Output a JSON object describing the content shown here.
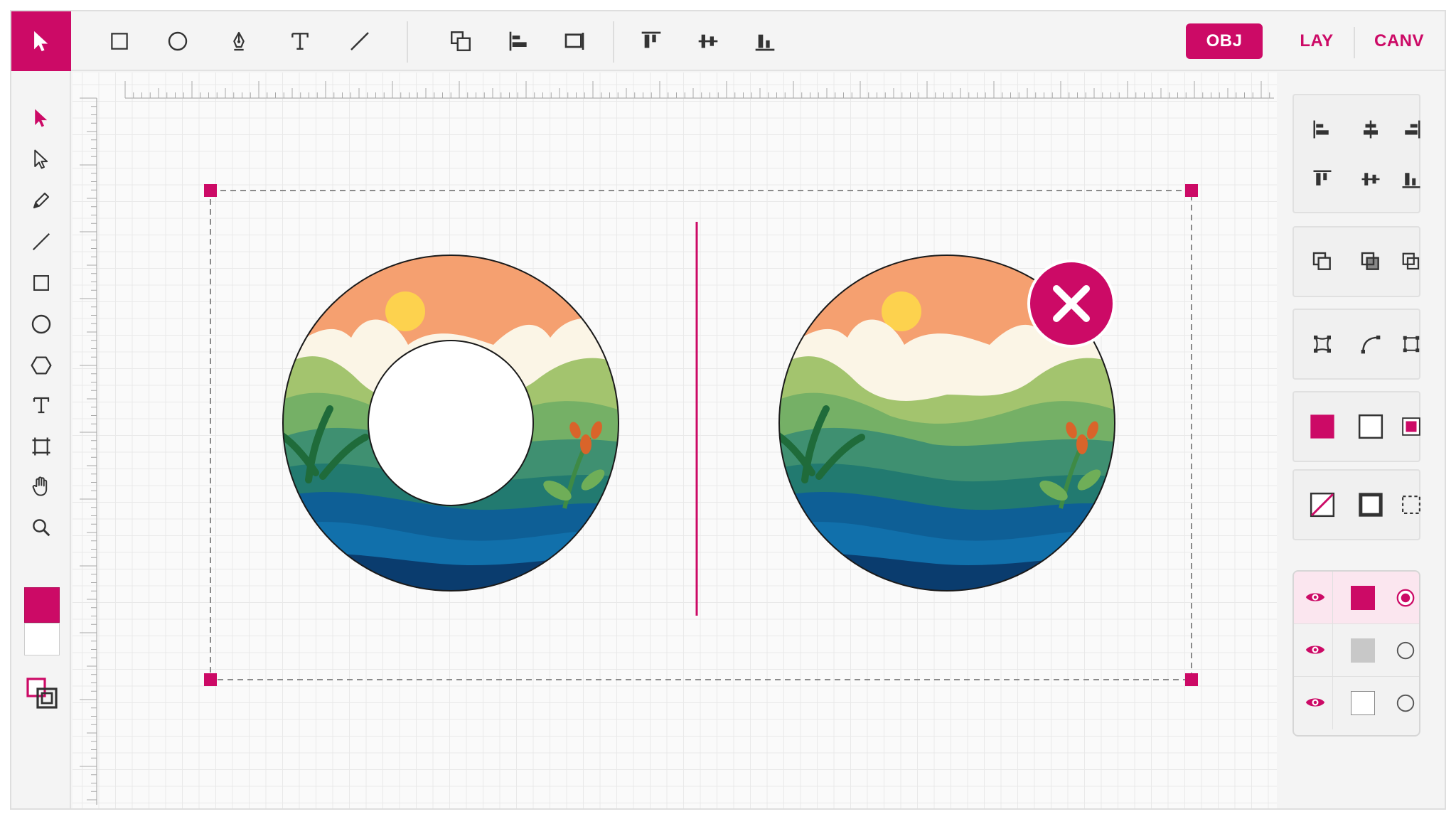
{
  "toolbar": {
    "modes": [
      {
        "label": "OBJ",
        "active": true
      },
      {
        "label": "LAY",
        "active": false
      },
      {
        "label": "CANV",
        "active": false
      }
    ],
    "tools": [
      "rectangle-icon",
      "ellipse-icon",
      "pen-icon",
      "text-icon",
      "line-icon",
      "arrange-icon",
      "align-left-icon",
      "crop-icon",
      "align-top-icon",
      "align-middle-icon",
      "align-bottom-icon"
    ]
  },
  "left_tools": [
    "select-icon",
    "direct-select-icon",
    "pencil-icon",
    "line-icon",
    "rectangle-icon",
    "ellipse-icon",
    "polygon-icon",
    "text-icon",
    "artboard-icon",
    "hand-icon",
    "zoom-icon",
    "swap-colors-icon"
  ],
  "colors": {
    "accent": "#cc0a66",
    "fill": "#cc0a66",
    "stroke": "#ffffff",
    "sky": "#f5a070",
    "sun": "#fdd24e",
    "cloud": "#fbf5e6",
    "water": "#0e5f96"
  },
  "canvas": {
    "left_object": "ring-shape",
    "right_object": "circle-shape",
    "badge": "close-icon"
  },
  "right_panel": {
    "groups": [
      "align",
      "arrange",
      "path-ops",
      "fill-modes",
      "stroke-modes"
    ],
    "layers": [
      {
        "visible": true,
        "swatch": "#cc0a66",
        "selected": true
      },
      {
        "visible": true,
        "swatch": "#c8c8c8",
        "selected": false
      },
      {
        "visible": true,
        "swatch": "#ffffff",
        "selected": false
      }
    ]
  }
}
